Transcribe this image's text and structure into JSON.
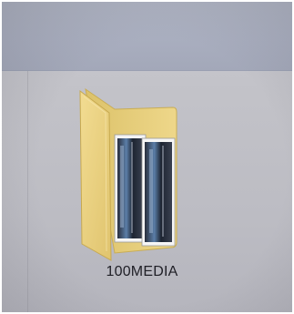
{
  "folder": {
    "name": "100MEDIA",
    "icon": "folder-with-photos-icon"
  },
  "colors": {
    "toolbar": "#aab0c0",
    "folder_back": "#e8cf78",
    "folder_front": "#f0d989",
    "label_text": "#1f1f26"
  }
}
